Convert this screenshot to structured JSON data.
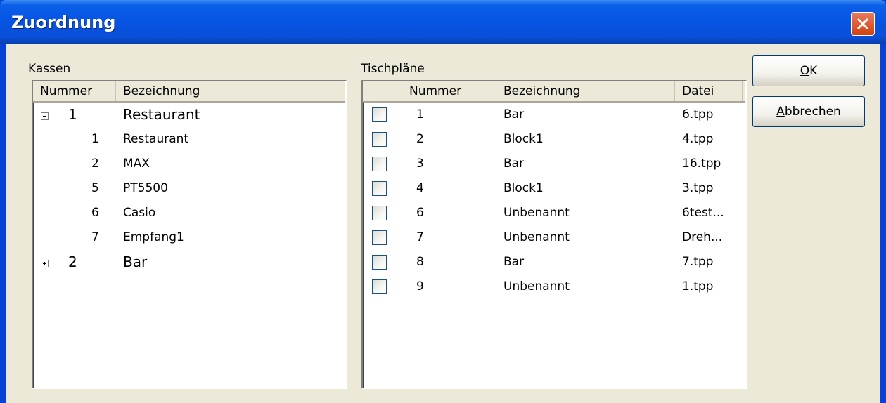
{
  "window": {
    "title": "Zuordnung"
  },
  "kassen": {
    "label": "Kassen",
    "columns": [
      "Nummer",
      "Bezeichnung"
    ],
    "groups": [
      {
        "nummer": "1",
        "bezeichnung": "Restaurant",
        "expanded": true,
        "children": [
          {
            "nummer": "1",
            "bezeichnung": "Restaurant"
          },
          {
            "nummer": "2",
            "bezeichnung": "MAX"
          },
          {
            "nummer": "5",
            "bezeichnung": "PT5500"
          },
          {
            "nummer": "6",
            "bezeichnung": "Casio"
          },
          {
            "nummer": "7",
            "bezeichnung": "Empfang1"
          }
        ]
      },
      {
        "nummer": "2",
        "bezeichnung": "Bar",
        "expanded": false,
        "children": []
      }
    ]
  },
  "tischplaene": {
    "label": "Tischpläne",
    "columns": [
      "",
      "Nummer",
      "Bezeichnung",
      "Datei"
    ],
    "rows": [
      {
        "checked": false,
        "nummer": "1",
        "bezeichnung": "Bar",
        "datei": "6.tpp"
      },
      {
        "checked": false,
        "nummer": "2",
        "bezeichnung": "Block1",
        "datei": "4.tpp"
      },
      {
        "checked": false,
        "nummer": "3",
        "bezeichnung": "Bar",
        "datei": "16.tpp"
      },
      {
        "checked": false,
        "nummer": "4",
        "bezeichnung": "Block1",
        "datei": "3.tpp"
      },
      {
        "checked": false,
        "nummer": "6",
        "bezeichnung": "Unbenannt",
        "datei": "6test..."
      },
      {
        "checked": false,
        "nummer": "7",
        "bezeichnung": "Unbenannt",
        "datei": "Dreh..."
      },
      {
        "checked": false,
        "nummer": "8",
        "bezeichnung": "Bar",
        "datei": "7.tpp"
      },
      {
        "checked": false,
        "nummer": "9",
        "bezeichnung": "Unbenannt",
        "datei": "1.tpp"
      }
    ]
  },
  "buttons": {
    "ok": {
      "mnemonic": "O",
      "rest": "K"
    },
    "cancel": {
      "mnemonic": "A",
      "rest": "bbrechen"
    }
  },
  "icons": {
    "close": "close-icon",
    "expand": "plus-box-icon",
    "collapse": "minus-box-icon"
  },
  "colors": {
    "titlebar": "#0754e3",
    "client": "#ece9d8",
    "close": "#d2410f"
  }
}
